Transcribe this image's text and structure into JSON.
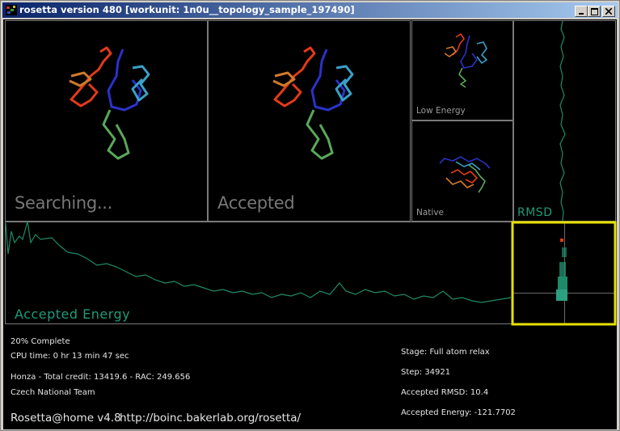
{
  "window": {
    "title": "rosetta version 480 [workunit: 1n0u__topology_sample_197490]",
    "controls": [
      "minimize",
      "maximize",
      "close"
    ]
  },
  "panels": {
    "searching": "Searching...",
    "accepted": "Accepted",
    "low_energy": "Low  Energy",
    "native": "Native",
    "rmsd": "RMSD",
    "accepted_energy": "Accepted  Energy"
  },
  "status": {
    "complete": "20%  Complete",
    "cpu_time": "CPU  time:  0  hr  13  min  47  sec",
    "user_credit": "Honza  -  Total  credit:  13419.6  -  RAC:  249.656",
    "team": "Czech  National  Team",
    "stage": "Stage:  Full  atom  relax",
    "step": "Step:  34921",
    "accepted_rmsd": "Accepted  RMSD:    10.4",
    "accepted_energy": "Accepted  Energy:  -121.7702"
  },
  "footer": {
    "app": "Rosetta@home    v4.8",
    "url": "http://boinc.bakerlab.org/rosetta/"
  },
  "colors": {
    "trace": "#1f8a6a",
    "highlight": "#e8e000",
    "protein": [
      "#e43a1a",
      "#2a32c8",
      "#5aa85a",
      "#3aa0c8",
      "#d07a2a"
    ]
  }
}
